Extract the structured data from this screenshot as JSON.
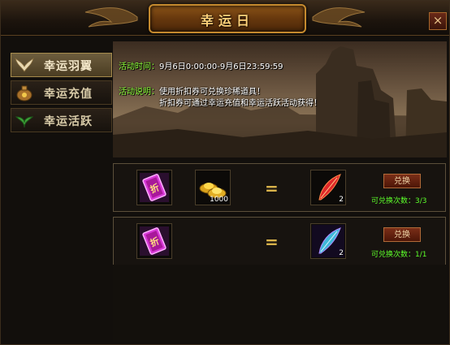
{
  "window": {
    "title": "幸运日",
    "close_label": "×"
  },
  "sidebar": {
    "items": [
      {
        "label": "幸运羽翼",
        "icon": "wing-icon",
        "active": true
      },
      {
        "label": "幸运充值",
        "icon": "gold-sack-icon",
        "active": false
      },
      {
        "label": "幸运活跃",
        "icon": "leaf-icon",
        "active": false
      }
    ]
  },
  "info": {
    "time_label": "活动时间：",
    "time_value": "9月6日0:00:00-9月6日23:59:59",
    "desc_label": "活动说明：",
    "desc_line1": "使用折扣券可兑换珍稀道具！",
    "desc_line2": "折扣券可通过幸运充值和幸运活跃活动获得！"
  },
  "exchanges": [
    {
      "ticket_icon": "discount-ticket-icon",
      "cost_icon": "gold-ingot-icon",
      "cost_amount": "1000",
      "equals": "=",
      "reward_icon": "red-feather-icon",
      "reward_count": "2",
      "button_label": "兑换",
      "limit_text": "可兑换次数：3/3"
    },
    {
      "ticket_icon": "discount-ticket-icon",
      "equals": "=",
      "reward_icon": "blue-feather-icon",
      "reward_count": "2",
      "button_label": "兑换",
      "limit_text": "可兑换次数：1/1"
    }
  ],
  "colors": {
    "accent_gold": "#ffd27a",
    "highlight_green": "#5cff2a",
    "button_red": "#7a2e18"
  }
}
